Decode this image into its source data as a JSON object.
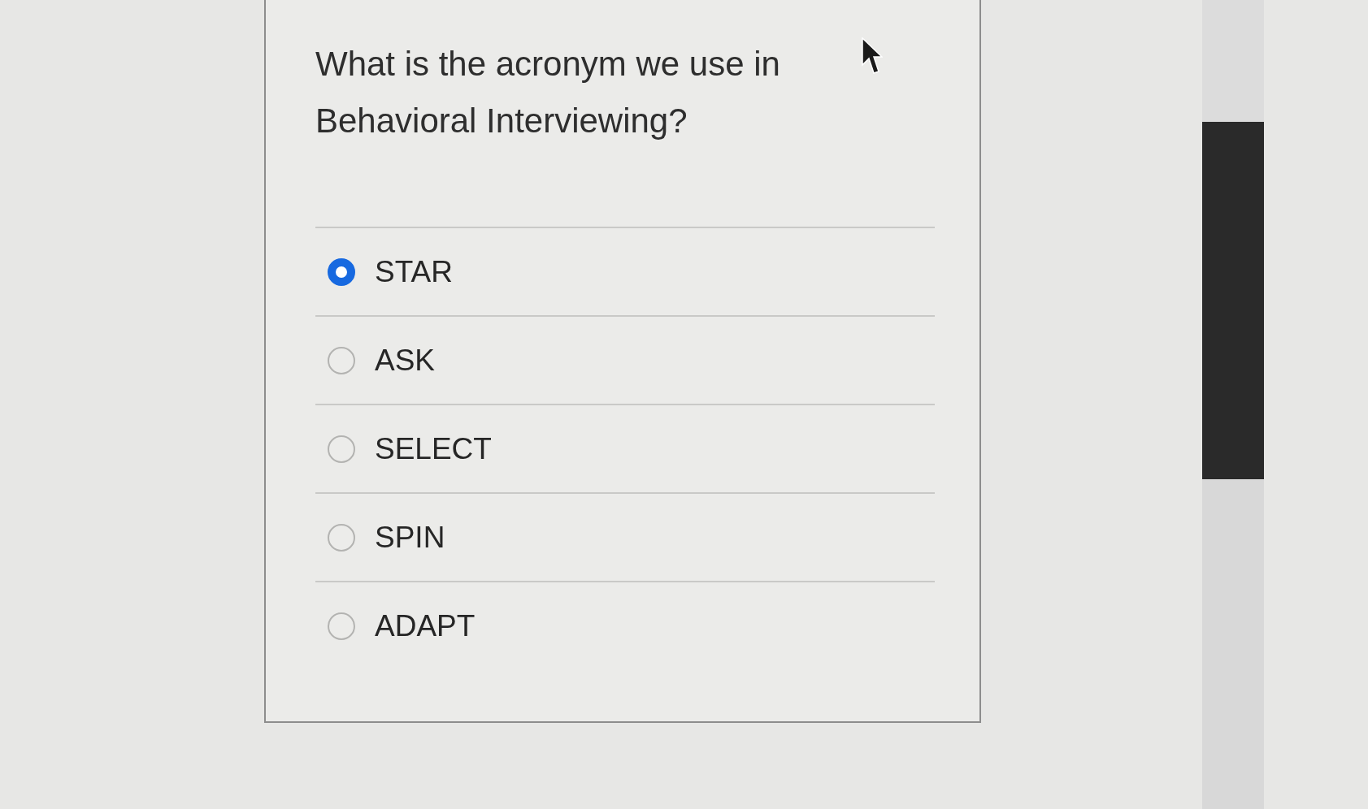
{
  "question": {
    "text": "What is the acronym we use in Behavioral Interviewing?"
  },
  "options": [
    {
      "label": "STAR",
      "selected": true
    },
    {
      "label": "ASK",
      "selected": false
    },
    {
      "label": "SELECT",
      "selected": false
    },
    {
      "label": "SPIN",
      "selected": false
    },
    {
      "label": "ADAPT",
      "selected": false
    }
  ]
}
